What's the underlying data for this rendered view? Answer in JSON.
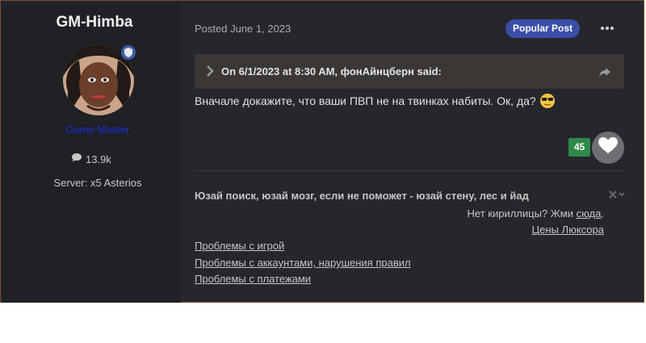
{
  "author": {
    "name": "GM-Himba",
    "role": "Game Master",
    "post_count": "13.9k",
    "server": "Server: x5 Asterios"
  },
  "post": {
    "posted": "Posted June 1, 2023",
    "badge": "Popular Post",
    "quote_header": "On 6/1/2023 at 8:30 AM, фонАйнцберн said:",
    "body": "Вначале докажите, что ваши ПВП не на твинках набиты. Ок, да?",
    "reaction_count": "45"
  },
  "signature": {
    "title": "Юзай поиск, юзай мозг, если не поможет - юзай стену, лес и йад",
    "line1_prefix": "Нет кириллицы? Жми ",
    "line1_link": "сюда",
    "line1_suffix": ".",
    "line2": "Цены Люксора",
    "links": [
      "Проблемы с игрой",
      "Проблемы с аккаунтами, нарушения правил",
      "Проблемы с платежами"
    ]
  },
  "colors": {
    "background": "#25272d",
    "sidebar": "#1f2126",
    "badge": "#3a4ea8",
    "role": "#1a2bd8",
    "reputation": "#2f8a4a"
  },
  "icons": [
    "comment-icon",
    "more-icon",
    "chevron-right-icon",
    "share-icon",
    "heart-icon",
    "close-icon",
    "sunglasses-emoji"
  ]
}
